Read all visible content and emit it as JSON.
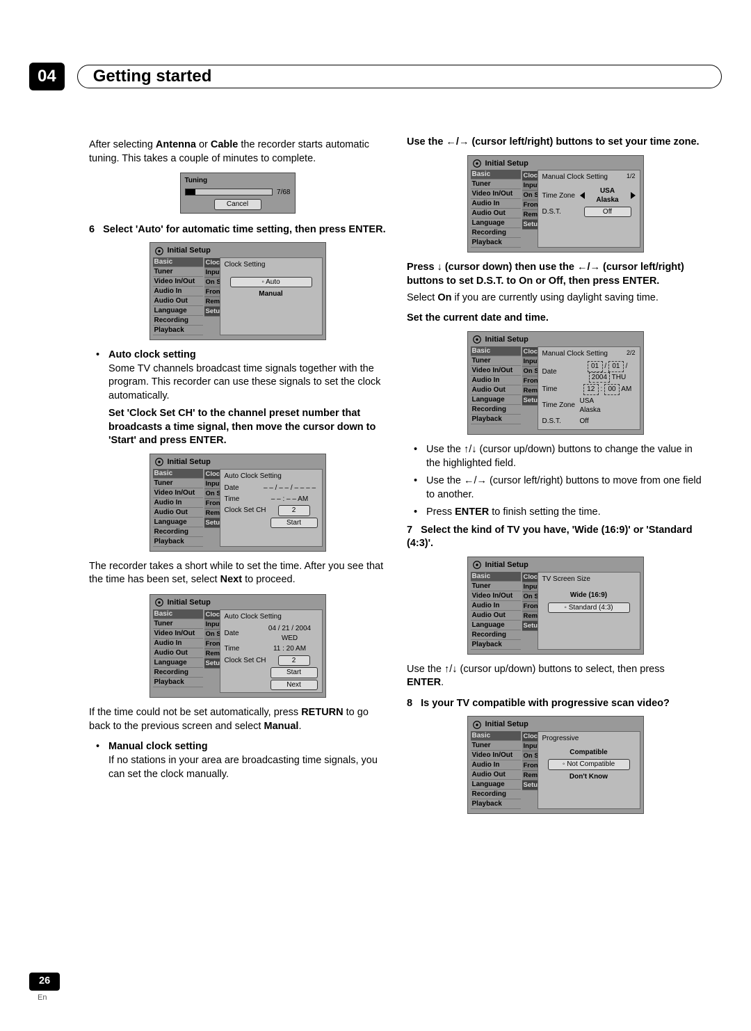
{
  "header": {
    "chapter_number": "04",
    "chapter_title": "Getting started"
  },
  "page_footer": {
    "page_number": "26",
    "lang": "En"
  },
  "menu_items": [
    "Basic",
    "Tuner",
    "Video In/Out",
    "Audio In",
    "Audio Out",
    "Language",
    "Recording",
    "Playback"
  ],
  "sub_items_full": [
    "Clock",
    "Input",
    "On S",
    "Front",
    "Remo",
    "Setup"
  ],
  "sub_items_cut": [
    "Clock",
    "Input",
    "On S",
    "Front",
    "Remo",
    "Setup"
  ],
  "left": {
    "p1": "After selecting Antenna or Cable the recorder starts automatic tuning. This takes a couple of minutes to complete.",
    "tuning": {
      "title": "Tuning",
      "count": "7/68",
      "cancel": "Cancel"
    },
    "step6": {
      "num": "6",
      "text": "Select 'Auto' for automatic time setting, then press ENTER."
    },
    "osd_clock": {
      "panel_title": "Clock Setting",
      "auto": "Auto",
      "manual": "Manual"
    },
    "bullet_auto_head": "Auto clock setting",
    "bullet_auto_body": "Some TV channels broadcast time signals together with the program. This recorder can use these signals to set the clock automatically.",
    "bold_setclock": "Set 'Clock Set CH' to the channel preset number that broadcasts a time signal, then move the cursor down to 'Start' and press ENTER.",
    "osd_auto": {
      "panel_title": "Auto Clock Setting",
      "date_lbl": "Date",
      "date_val": "– – / – – / – – – –",
      "time_lbl": "Time",
      "time_val": "– – : – –  AM",
      "ch_lbl": "Clock Set CH",
      "ch_val": "2",
      "start": "Start"
    },
    "p2_a": "The recorder takes a short while to set the time. After you see that the time has been set, select ",
    "p2_b": "Next",
    "p2_c": " to proceed.",
    "osd_auto2": {
      "panel_title": "Auto Clock Setting",
      "date_lbl": "Date",
      "date_val": "04 / 21 / 2004  WED",
      "time_lbl": "Time",
      "time_val": "11 : 20  AM",
      "ch_lbl": "Clock Set CH",
      "ch_val": "2",
      "start": "Start",
      "next": "Next"
    },
    "p3_a": "If the time could not be set automatically, press ",
    "p3_b": "RETURN",
    "p3_c": " to go back to the previous screen and select ",
    "p3_d": "Manual",
    "p3_e": ".",
    "bullet_manual_head": "Manual clock setting",
    "bullet_manual_body": "If no stations in your area are broadcasting time signals, you can set the clock manually."
  },
  "right": {
    "heading_tz_a": "Use the ",
    "heading_tz_b": " (cursor left/right) buttons to set your time zone.",
    "osd_tz": {
      "panel_title": "Manual Clock Setting",
      "page": "1/2",
      "tz_lbl": "Time Zone",
      "tz_top": "USA",
      "tz_bot": "Alaska",
      "dst_lbl": "D.S.T.",
      "dst_val": "Off"
    },
    "heading_dst_a": "Press ",
    "heading_dst_b": " (cursor down) then use the ",
    "heading_dst_c": " (cursor left/right) buttons to set D.S.T. to On or Off, then press ENTER.",
    "p_on_a": "Select ",
    "p_on_b": "On",
    "p_on_c": " if you are currently using daylight saving time.",
    "heading_setdate": "Set the current date and time.",
    "osd_date": {
      "panel_title": "Manual Clock Setting",
      "page": "2/2",
      "date_lbl": "Date",
      "date_val_m": "01",
      "date_val_d": "01",
      "date_val_y": "2004",
      "date_dow": "THU",
      "time_lbl": "Time",
      "time_h": "12",
      "time_m": "00",
      "time_ampm": "AM",
      "tz_lbl": "Time Zone",
      "tz_top": "USA",
      "tz_bot": "Alaska",
      "dst_lbl": "D.S.T.",
      "dst_val": "Off"
    },
    "b1_a": "Use the ",
    "b1_b": " (cursor up/down) buttons to change the value in the highlighted field.",
    "b2_a": "Use the ",
    "b2_b": " (cursor left/right) buttons to move from one field to another.",
    "b3_a": "Press ",
    "b3_b": "ENTER",
    "b3_c": " to finish setting the time.",
    "step7": {
      "num": "7",
      "text": "Select the kind of TV you have, 'Wide (16:9)' or 'Standard (4:3)'."
    },
    "osd_tv": {
      "panel_title": "TV Screen Size",
      "opt1": "Wide (16:9)",
      "opt2": "Standard (4:3)"
    },
    "p_tv_a": "Use the ",
    "p_tv_b": " (cursor up/down) buttons to select, then press ",
    "p_tv_c": "ENTER",
    "p_tv_d": ".",
    "step8": {
      "num": "8",
      "text": "Is your TV compatible with progressive scan video?"
    },
    "osd_prog": {
      "panel_title": "Progressive",
      "opt1": "Compatible",
      "opt2": "Not Compatible",
      "opt3": "Don't Know"
    },
    "initial_setup": "Initial Setup"
  }
}
